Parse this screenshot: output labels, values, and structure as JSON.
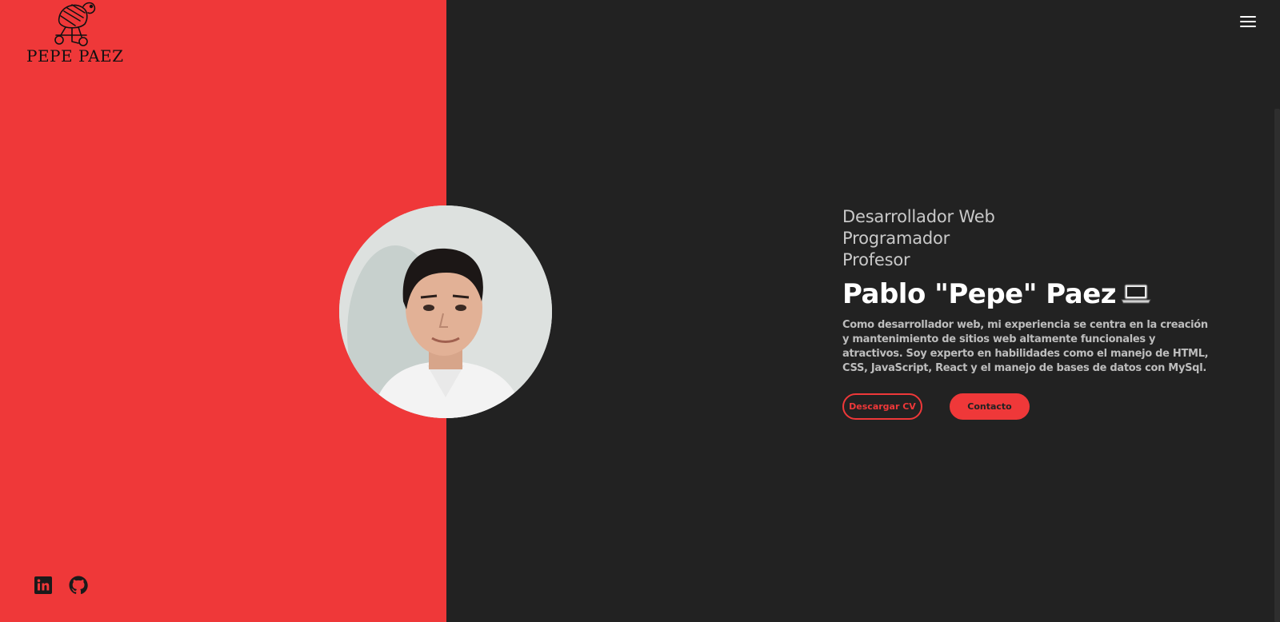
{
  "brand": {
    "logo_text": "PEPE PAEZ",
    "logo_icon": "robot-turtle-logo"
  },
  "header": {
    "menu_icon": "hamburger-menu-icon"
  },
  "hero": {
    "roles": [
      "Desarrollador Web",
      "Programador",
      "Profesor"
    ],
    "name": "Pablo \"Pepe\" Paez",
    "name_emoji": "laptop-icon",
    "description": "Como desarrollador web, mi experiencia se centra en la creación y mantenimiento de sitios web altamente funcionales y atractivos. Soy experto en habilidades como el manejo de HTML, CSS, JavaScript, React y el manejo de bases de datos con MySql.",
    "buttons": {
      "download_cv": "Descargar CV",
      "contact": "Contacto"
    }
  },
  "social": [
    {
      "icon": "linkedin-icon"
    },
    {
      "icon": "github-icon"
    }
  ],
  "colors": {
    "accent": "#ef3839",
    "background": "#222222",
    "text": "#ffffff",
    "muted": "#c9c9c9"
  }
}
